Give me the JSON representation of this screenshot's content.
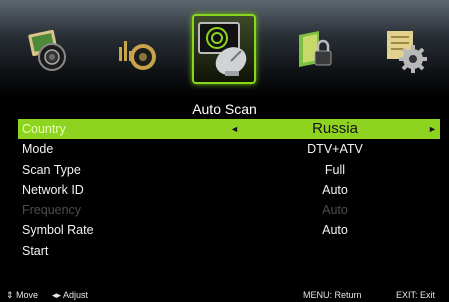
{
  "menu_icons": [
    {
      "name": "picture-icon",
      "selected": false
    },
    {
      "name": "sound-icon",
      "selected": false
    },
    {
      "name": "channel-icon",
      "selected": true
    },
    {
      "name": "lock-icon",
      "selected": false
    },
    {
      "name": "setup-icon",
      "selected": false
    }
  ],
  "title": "Auto Scan",
  "rows": [
    {
      "label": "Country",
      "value": "Russia"
    },
    {
      "label": "Mode",
      "value": "DTV+ATV"
    },
    {
      "label": "Scan Type",
      "value": "Full"
    },
    {
      "label": "Network ID",
      "value": "Auto"
    },
    {
      "label": "Frequency",
      "value": "Auto"
    },
    {
      "label": "Symbol Rate",
      "value": "Auto"
    },
    {
      "label": "Start",
      "value": ""
    }
  ],
  "arrows": {
    "left": "◄",
    "right": "►"
  },
  "footer": {
    "move": "⇕ Move",
    "adjust": "◂▸ Adjust",
    "menu": "MENU: Return",
    "exit": "EXIT: Exit"
  },
  "colors": {
    "highlight": "#8ed31f",
    "background": "#000000",
    "disabled_text": "#4d4d4d"
  }
}
